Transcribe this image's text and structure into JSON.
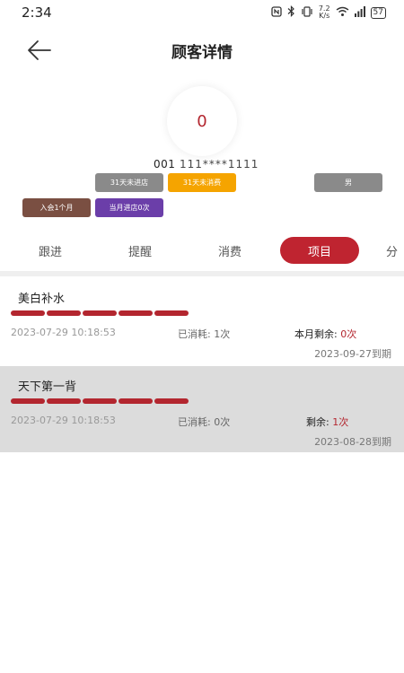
{
  "status": {
    "time": "2:34",
    "network_speed_top": "7.2",
    "network_speed_bottom": "K/s",
    "battery": "57"
  },
  "header": {
    "title": "顾客详情"
  },
  "customer": {
    "avatar_text": "0",
    "id": "001",
    "phone": "111****1111",
    "tags": {
      "no_visit": "31天未进店",
      "no_consume": "31天未消费",
      "gender": "男",
      "member_duration": "入会1个月",
      "month_visits": "当月进店0次"
    }
  },
  "tabs": [
    {
      "label": "跟进"
    },
    {
      "label": "提醒"
    },
    {
      "label": "消费"
    },
    {
      "label": "项目"
    },
    {
      "label": "分"
    }
  ],
  "projects": [
    {
      "name": "美白补水",
      "date": "2023-07-29 10:18:53",
      "used_label": "已消耗: ",
      "used_value": "1次",
      "remain_label": "本月剩余: ",
      "remain_value": "0次",
      "expire": "2023-09-27到期"
    },
    {
      "name": "天下第一背",
      "date": "2023-07-29 10:18:53",
      "used_label": "已消耗: ",
      "used_value": "0次",
      "remain_label": "剩余: ",
      "remain_value": "1次",
      "expire": "2023-08-28到期"
    }
  ],
  "colors": {
    "accent": "#bf2430",
    "tag_grey": "#8a8a8a",
    "tag_orange": "#f5a400",
    "tag_brown": "#7a4f42",
    "tag_purple": "#6b3ea9"
  }
}
